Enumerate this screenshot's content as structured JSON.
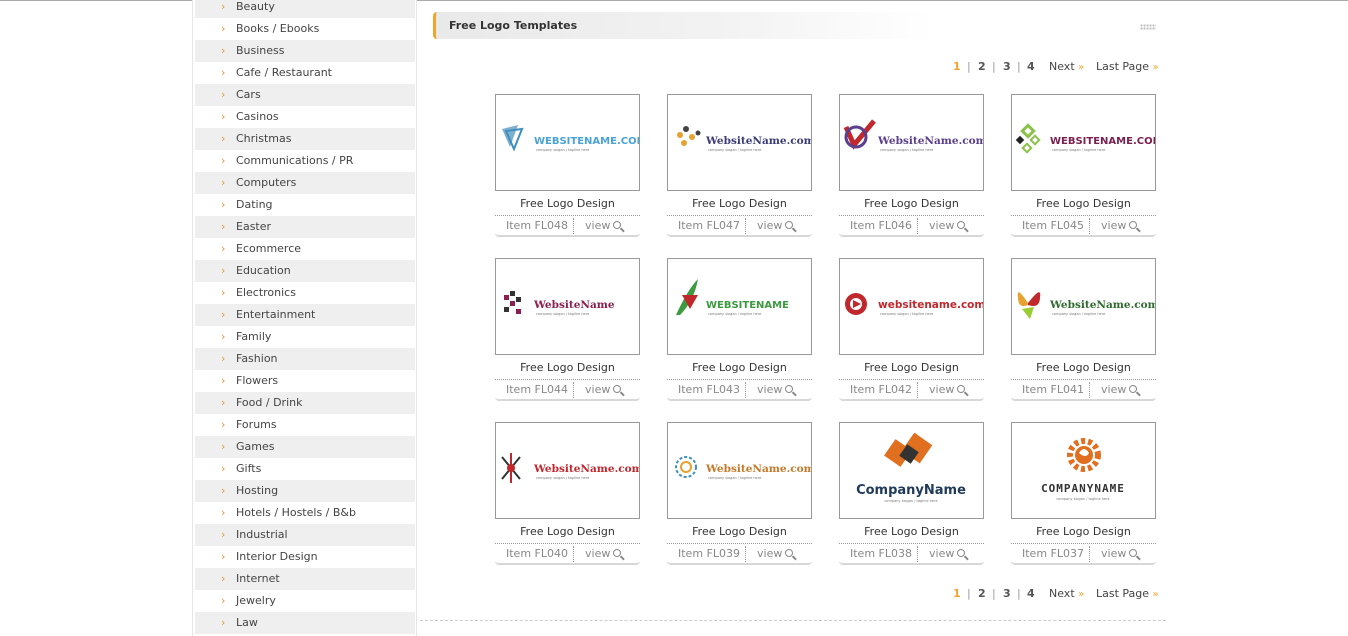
{
  "sidebar": {
    "items": [
      {
        "label": "Beauty"
      },
      {
        "label": "Books / Ebooks"
      },
      {
        "label": "Business"
      },
      {
        "label": "Cafe / Restaurant"
      },
      {
        "label": "Cars"
      },
      {
        "label": "Casinos"
      },
      {
        "label": "Christmas"
      },
      {
        "label": "Communications / PR"
      },
      {
        "label": "Computers"
      },
      {
        "label": "Dating"
      },
      {
        "label": "Easter"
      },
      {
        "label": "Ecommerce"
      },
      {
        "label": "Education"
      },
      {
        "label": "Electronics"
      },
      {
        "label": "Entertainment"
      },
      {
        "label": "Family"
      },
      {
        "label": "Fashion"
      },
      {
        "label": "Flowers"
      },
      {
        "label": "Food / Drink"
      },
      {
        "label": "Forums"
      },
      {
        "label": "Games"
      },
      {
        "label": "Gifts"
      },
      {
        "label": "Hosting"
      },
      {
        "label": "Hotels / Hostels / B&b"
      },
      {
        "label": "Industrial"
      },
      {
        "label": "Interior Design"
      },
      {
        "label": "Internet"
      },
      {
        "label": "Jewelry"
      },
      {
        "label": "Law"
      }
    ],
    "arrow": "›"
  },
  "main": {
    "title": "Free Logo Templates",
    "pager": {
      "pages": [
        "1",
        "2",
        "3",
        "4"
      ],
      "separator": "|",
      "next": "Next",
      "last": "Last Page",
      "double_arrow": "»"
    },
    "cards": [
      {
        "title": "Free Logo Design",
        "item": "Item FL048",
        "view": "view",
        "logo_text": "WEBSITENAME.COM"
      },
      {
        "title": "Free Logo Design",
        "item": "Item FL047",
        "view": "view",
        "logo_text": "WebsiteName.com"
      },
      {
        "title": "Free Logo Design",
        "item": "Item FL046",
        "view": "view",
        "logo_text": "WebsiteName.com"
      },
      {
        "title": "Free Logo Design",
        "item": "Item FL045",
        "view": "view",
        "logo_text": "WEBSITENAME.COM"
      },
      {
        "title": "Free Logo Design",
        "item": "Item FL044",
        "view": "view",
        "logo_text": "WebsiteName"
      },
      {
        "title": "Free Logo Design",
        "item": "Item FL043",
        "view": "view",
        "logo_text": "WEBSITENAME"
      },
      {
        "title": "Free Logo Design",
        "item": "Item FL042",
        "view": "view",
        "logo_text": "websitename.com"
      },
      {
        "title": "Free Logo Design",
        "item": "Item FL041",
        "view": "view",
        "logo_text": "WebsiteName.com"
      },
      {
        "title": "Free Logo Design",
        "item": "Item FL040",
        "view": "view",
        "logo_text": "WebsiteName.com"
      },
      {
        "title": "Free Logo Design",
        "item": "Item FL039",
        "view": "view",
        "logo_text": "WebsiteName.com"
      },
      {
        "title": "Free Logo Design",
        "item": "Item FL038",
        "view": "view",
        "logo_text": "CompanyName"
      },
      {
        "title": "Free Logo Design",
        "item": "Item FL037",
        "view": "view",
        "logo_text": "COMPANYNAME"
      }
    ],
    "slogan": "company slogan / tagline here"
  }
}
